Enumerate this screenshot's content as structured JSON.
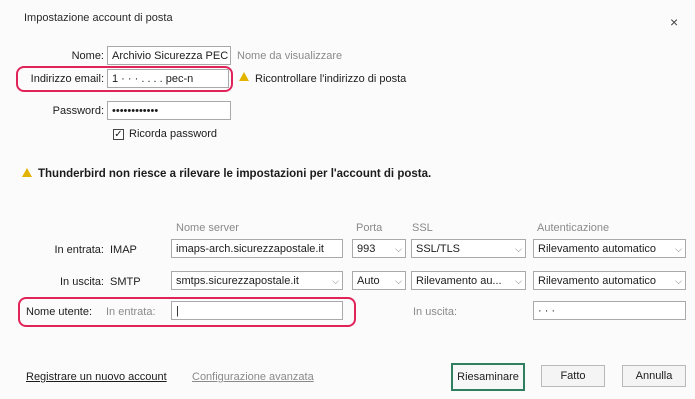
{
  "window": {
    "title": "Impostazione account di posta",
    "close_label": "×"
  },
  "identity": {
    "name_label": "Nome:",
    "name_value": "Archivio Sicurezza PEC",
    "display_name_hint": "Nome da visualizzare",
    "email_label": "Indirizzo email:",
    "email_value": "1  ·  ·  ·  .  .  .  .   pec-n",
    "recheck_link": "Ricontrollare l'indirizzo di posta",
    "password_label": "Password:",
    "password_value": "••••••••••••",
    "remember_label": "Ricorda password",
    "remember_checked": true
  },
  "warning": {
    "text": "Thunderbird non riesce a rilevare le impostazioni per l'account di posta."
  },
  "server_table": {
    "headers": {
      "server": "Nome server",
      "port": "Porta",
      "ssl": "SSL",
      "auth": "Autenticazione"
    },
    "incoming": {
      "label": "In entrata:",
      "protocol": "IMAP",
      "server": "imaps-arch.sicurezzapostale.it",
      "port": "993",
      "ssl": "SSL/TLS",
      "auth": "Rilevamento automatico"
    },
    "outgoing": {
      "label": "In uscita:",
      "protocol": "SMTP",
      "server": "smtps.sicurezzapostale.it",
      "port": "Auto",
      "ssl": "Rilevamento au...",
      "auth": "Rilevamento automatico"
    },
    "username": {
      "label": "Nome utente:",
      "incoming_label": "In entrata:",
      "incoming_value": "|",
      "outgoing_label": "In uscita:",
      "outgoing_value": "·   ·   ·"
    }
  },
  "footer": {
    "register_button": "Registrare un nuovo account",
    "advanced_button": "Configurazione avanzata",
    "recheck_button": "Riesaminare",
    "done_button": "Fatto",
    "cancel_button": "Annulla"
  },
  "colors": {
    "highlight_outline": "#e0245a",
    "primary_button_border": "#2f7f61",
    "warning_icon": "#e2b400"
  }
}
